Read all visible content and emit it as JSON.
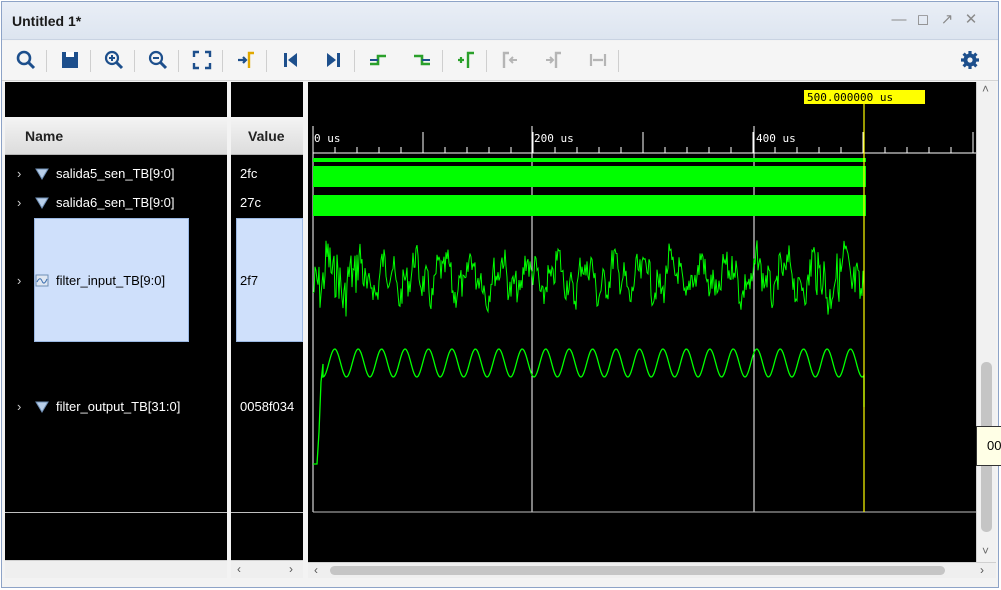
{
  "window": {
    "title": "Untitled 1*"
  },
  "toolbar": {
    "icons": [
      "search-icon",
      "save-icon",
      "zoom-in-icon",
      "zoom-out-icon",
      "zoom-fit-icon",
      "go-to-cursor-icon",
      "go-to-time-zero-icon",
      "go-to-last-time-icon",
      "previous-transition-icon",
      "next-transition-icon",
      "add-marker-icon",
      "previous-marker-icon",
      "next-marker-icon",
      "swap-cursors-icon",
      "settings-gear-icon"
    ]
  },
  "columns": {
    "name": "Name",
    "value": "Value"
  },
  "signals": [
    {
      "name": "salida5_sen_TB[9:0]",
      "value": "2fc"
    },
    {
      "name": "salida6_sen_TB[9:0]",
      "value": "27c"
    },
    {
      "name": "filter_input_TB[9:0]",
      "value": "2f7"
    },
    {
      "name": "filter_output_TB[31:0]",
      "value": "0058f034"
    }
  ],
  "waveform": {
    "cursor_label": "500.000000 us",
    "time_ticks": [
      "0 us",
      "200 us",
      "400 us"
    ],
    "trace_color": "#00ff00",
    "cursor_color": "#ffff00",
    "tooltip_text": "00"
  }
}
